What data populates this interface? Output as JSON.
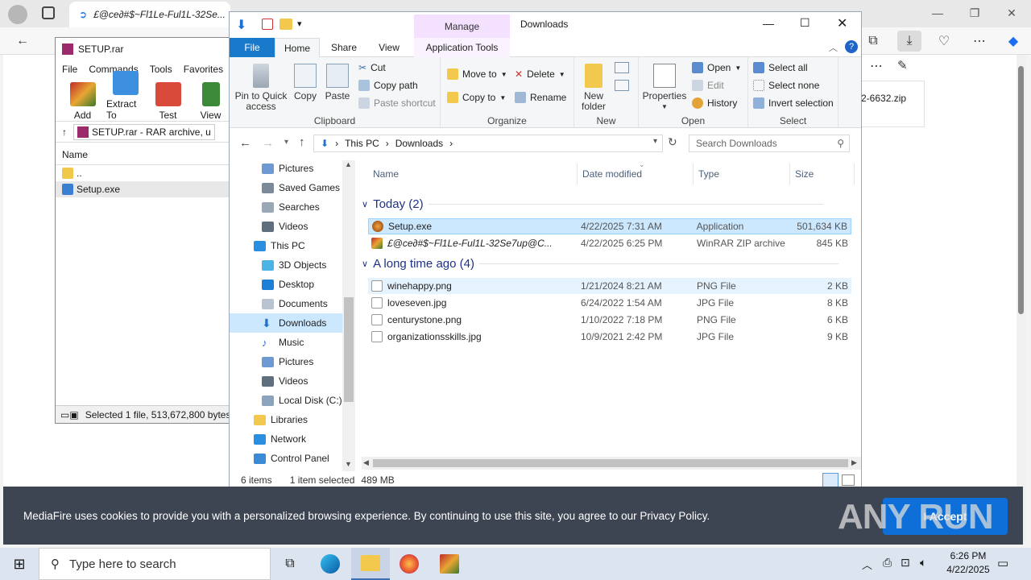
{
  "edge": {
    "tab_title": "£@ce∂#$~Fl1Le-Ful1L-32Se...",
    "download_chip_text": "2-6632.zip"
  },
  "winrar": {
    "title": "SETUP.rar",
    "menu": [
      "File",
      "Commands",
      "Tools",
      "Favorites"
    ],
    "tools": [
      "Add",
      "Extract To",
      "Test",
      "View"
    ],
    "path": "SETUP.rar - RAR archive, u",
    "col_name": "Name",
    "rows": [
      "..",
      "Setup.exe"
    ],
    "status": "Selected 1 file, 513,672,800 bytes"
  },
  "explorer": {
    "manage_label": "Manage",
    "window_title": "Downloads",
    "ribbon_tabs": [
      "File",
      "Home",
      "Share",
      "View",
      "Application Tools"
    ],
    "clipboard": {
      "pin": "Pin to Quick access",
      "copy": "Copy",
      "paste": "Paste",
      "cut": "Cut",
      "copy_path": "Copy path",
      "paste_shortcut": "Paste shortcut",
      "label": "Clipboard"
    },
    "organize": {
      "move_to": "Move to",
      "copy_to": "Copy to",
      "delete": "Delete",
      "rename": "Rename",
      "label": "Organize"
    },
    "new_group": {
      "new_folder": "New folder",
      "label": "New"
    },
    "open_group": {
      "properties": "Properties",
      "open": "Open",
      "edit": "Edit",
      "history": "History",
      "label": "Open"
    },
    "select_group": {
      "select_all": "Select all",
      "select_none": "Select none",
      "invert": "Invert selection",
      "label": "Select"
    },
    "address": [
      "This PC",
      "Downloads"
    ],
    "search_placeholder": "Search Downloads",
    "nav": [
      "Pictures",
      "Saved Games",
      "Searches",
      "Videos",
      "This PC",
      "3D Objects",
      "Desktop",
      "Documents",
      "Downloads",
      "Music",
      "Pictures",
      "Videos",
      "Local Disk (C:)",
      "Libraries",
      "Network",
      "Control Panel"
    ],
    "columns": [
      "Name",
      "Date modified",
      "Type",
      "Size"
    ],
    "groups": [
      {
        "title": "Today (2)",
        "files": [
          {
            "name": "Setup.exe",
            "date": "4/22/2025 7:31 AM",
            "type": "Application",
            "size": "501,634 KB"
          },
          {
            "name": "£@ce∂#$~Fl1Le-Ful1L-32Se7up@C...",
            "date": "4/22/2025 6:25 PM",
            "type": "WinRAR ZIP archive",
            "size": "845 KB"
          }
        ]
      },
      {
        "title": "A long time ago (4)",
        "files": [
          {
            "name": "winehappy.png",
            "date": "1/21/2024 8:21 AM",
            "type": "PNG File",
            "size": "2 KB"
          },
          {
            "name": "loveseven.jpg",
            "date": "6/24/2022 1:54 AM",
            "type": "JPG File",
            "size": "8 KB"
          },
          {
            "name": "centurystone.png",
            "date": "1/10/2022 7:18 PM",
            "type": "PNG File",
            "size": "6 KB"
          },
          {
            "name": "organizationsskills.jpg",
            "date": "10/9/2021 2:42 PM",
            "type": "JPG File",
            "size": "9 KB"
          }
        ]
      }
    ],
    "status_items": "6 items",
    "status_selected": "1 item selected",
    "status_size": "489 MB"
  },
  "cookie": {
    "text": "MediaFire uses cookies to provide you with a personalized browsing experience. By continuing to use this site, you agree to our Privacy Policy.",
    "accept": "I Accept",
    "watermark": "ANY RUN"
  },
  "taskbar": {
    "search_placeholder": "Type here to search",
    "time": "6:26 PM",
    "date": "4/22/2025"
  }
}
